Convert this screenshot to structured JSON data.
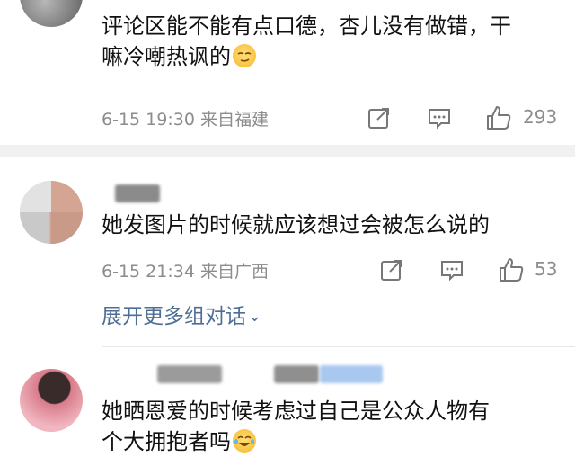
{
  "comments": [
    {
      "text_line1": "评论区能不能有点口德，杏儿没有做错，干",
      "text_line2": "嘛冷嘲热讽的",
      "emoji": "smirk-emoji",
      "time_location": "6-15 19:30 来自福建",
      "likes": "293"
    },
    {
      "text_line1": "她发图片的时候就应该想过会被怎么说的",
      "time_location": "6-15 21:34 来自广西",
      "likes": "53",
      "expand_label": "展开更多组对话"
    },
    {
      "text_line1": "她晒恩爱的时候考虑过自己是公众人物有",
      "text_line2": "个大拥抱者吗",
      "emoji": "laugh-cry-emoji"
    }
  ],
  "icons": {
    "share": "share-icon",
    "comment": "comment-icon",
    "like": "thumbs-up-icon",
    "expand": "chevron-down-icon"
  },
  "colors": {
    "meta_gray": "#8c8c8c",
    "link_blue": "#4f6e94",
    "divider": "#f1f1f1"
  }
}
